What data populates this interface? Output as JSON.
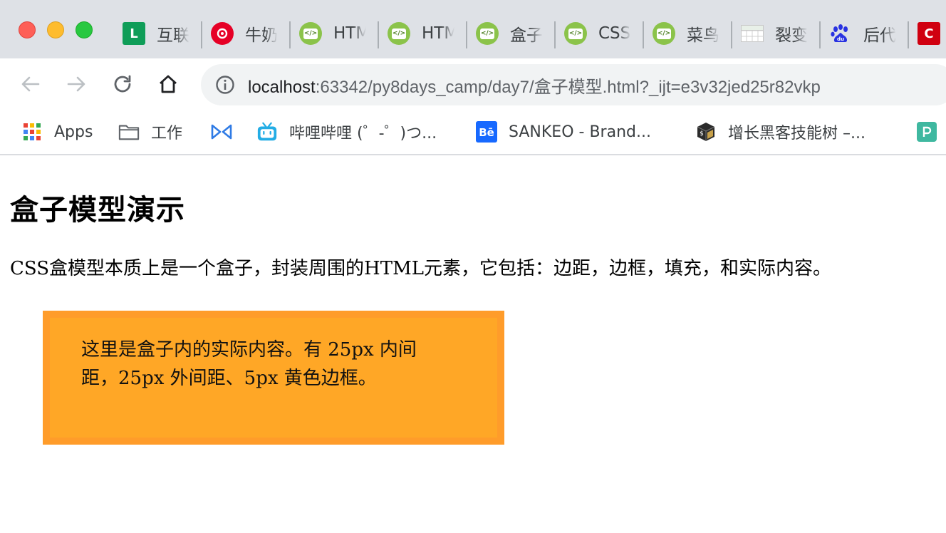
{
  "window": {
    "tabs": [
      {
        "label": "互联",
        "favicon": "L"
      },
      {
        "label": "牛奶",
        "favicon": ""
      },
      {
        "label": "HTM",
        "favicon": "</>"
      },
      {
        "label": "HTM",
        "favicon": "</>"
      },
      {
        "label": "盒子",
        "favicon": "</>"
      },
      {
        "label": "CSS",
        "favicon": "</>"
      },
      {
        "label": "菜鸟",
        "favicon": "</>"
      },
      {
        "label": "裂变",
        "favicon": ""
      },
      {
        "label": "后代",
        "favicon": ""
      },
      {
        "label": "",
        "favicon": "C"
      }
    ]
  },
  "toolbar": {
    "url_host": "localhost",
    "url_rest": ":63342/py8days_camp/day7/盒子模型.html?_ijt=e3v32jed25r82vkp"
  },
  "bookmarks": [
    {
      "label": "Apps",
      "icon": "apps-grid-icon"
    },
    {
      "label": "工作",
      "icon": "folder-icon"
    },
    {
      "label": "",
      "icon": "bowtie-icon"
    },
    {
      "label": "哔哩哔哩 (゜-゜)つ...",
      "icon": "bilibili-icon"
    },
    {
      "label": "SANKEO - Brand...",
      "icon": "behance-icon"
    },
    {
      "label": "增长黑客技能树 –...",
      "icon": "book-icon"
    },
    {
      "label": "",
      "icon": "p-icon"
    }
  ],
  "page": {
    "heading": "盒子模型演示",
    "paragraph": "CSS盒模型本质上是一个盒子，封装周围的HTML元素，它包括：边距，边框，填充，和实际内容。",
    "box_text": "这里是盒子内的实际内容。有 25px 内间距，25px 外间距、5px 黄色边框。"
  },
  "colors": {
    "box_background": "#ffa726",
    "box_border_dash": "#ffee33",
    "tabstrip": "#dee1e6"
  }
}
